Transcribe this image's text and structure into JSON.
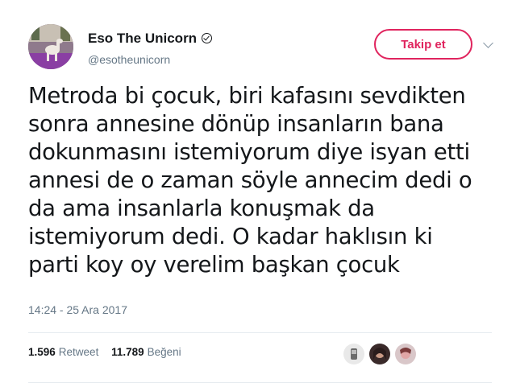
{
  "user": {
    "display_name": "Eso The Unicorn",
    "username": "@esotheunicorn"
  },
  "follow_label": "Takip et",
  "tweet": {
    "lines": [
      "Metroda bi çocuk, biri kafasını sevdikten",
      "sonra annesine dönüp insanların bana",
      "dokunmasını istemiyorum diye isyan etti",
      "annesi de o zaman söyle annecim dedi o",
      "da ama insanlarla konuşmak da",
      "istemiyorum dedi. O kadar haklısın ki",
      "parti koy oy verelim başkan çocuk"
    ]
  },
  "timestamp": "14:24 - 25 Ara 2017",
  "stats": {
    "retweets": "1.596",
    "retweets_label": "Retweet",
    "likes": "11.789",
    "likes_label": "Beğeni"
  },
  "colors": {
    "follow_accent": "#e0245e",
    "secondary_text": "#657786"
  }
}
